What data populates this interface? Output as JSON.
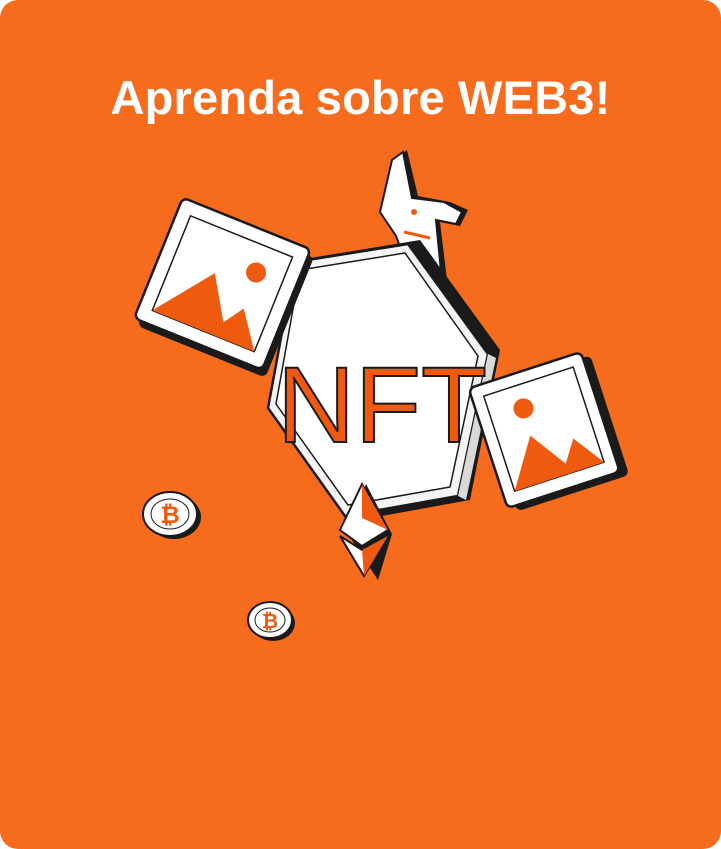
{
  "card": {
    "background_color": "#F76B1C",
    "title": "Aprenda sobre WEB3!"
  },
  "illustration": {
    "badge_text": "NFT",
    "accent_color": "#F05A0E",
    "outline_color": "#1A1A1A",
    "icons": [
      "image-frame-icon",
      "image-frame-icon",
      "unicorn-icon",
      "ethereum-icon",
      "bitcoin-coin-icon",
      "bitcoin-coin-icon"
    ]
  }
}
